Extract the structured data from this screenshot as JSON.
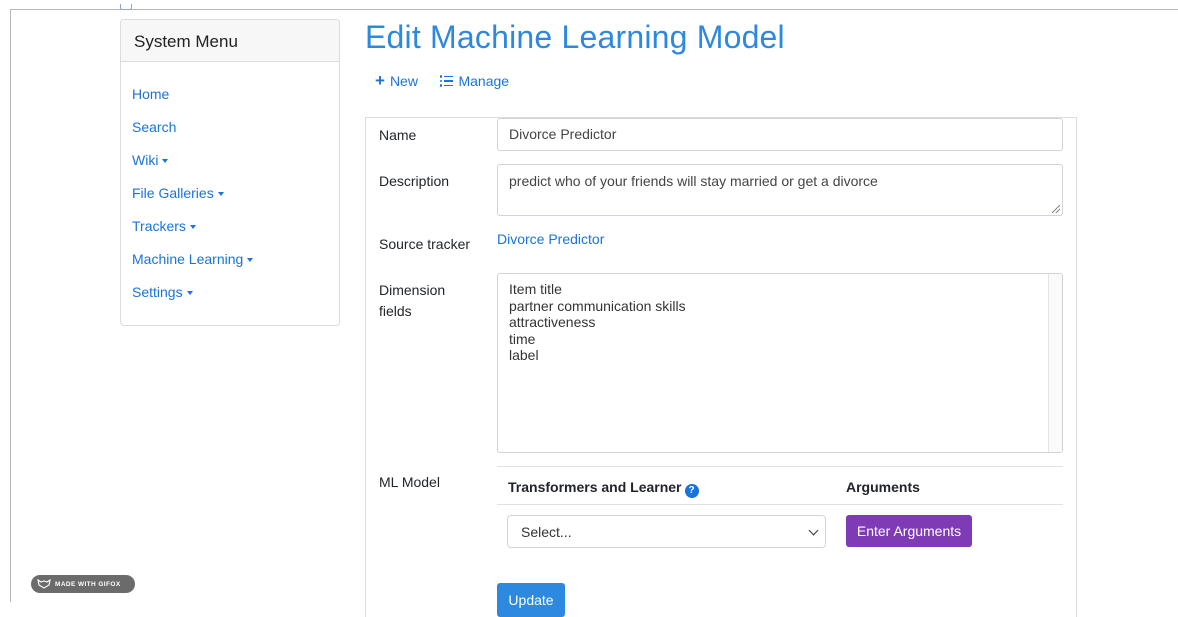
{
  "sidebar": {
    "title": "System Menu",
    "items": [
      {
        "label": "Home",
        "dropdown": false
      },
      {
        "label": "Search",
        "dropdown": false
      },
      {
        "label": "Wiki",
        "dropdown": true
      },
      {
        "label": "File Galleries",
        "dropdown": true
      },
      {
        "label": "Trackers",
        "dropdown": true
      },
      {
        "label": "Machine Learning",
        "dropdown": true
      },
      {
        "label": "Settings",
        "dropdown": true
      }
    ]
  },
  "page": {
    "title": "Edit Machine Learning Model",
    "actions": {
      "new_label": "New",
      "manage_label": "Manage"
    }
  },
  "form": {
    "name": {
      "label": "Name",
      "value": "Divorce Predictor"
    },
    "description": {
      "label": "Description",
      "value": "predict who of your friends will stay married or get a divorce"
    },
    "source_tracker": {
      "label": "Source tracker",
      "value": "Divorce Predictor"
    },
    "dimension_fields": {
      "label_line1": "Dimension",
      "label_line2": "fields",
      "values": [
        "Item title",
        "partner communication skills",
        "attractiveness",
        "time",
        "label"
      ]
    },
    "ml_model": {
      "label": "ML Model",
      "col_transformers": "Transformers and Learner",
      "col_arguments": "Arguments",
      "select_value": "Select...",
      "enter_arguments_label": "Enter Arguments"
    },
    "update_label": "Update"
  },
  "watermark": {
    "text": "MADE WITH GIFOX"
  },
  "colors": {
    "link": "#1a73d9",
    "title": "#2d88e0",
    "purple_button": "#7f3ab5",
    "primary_button": "#2d88e0"
  }
}
